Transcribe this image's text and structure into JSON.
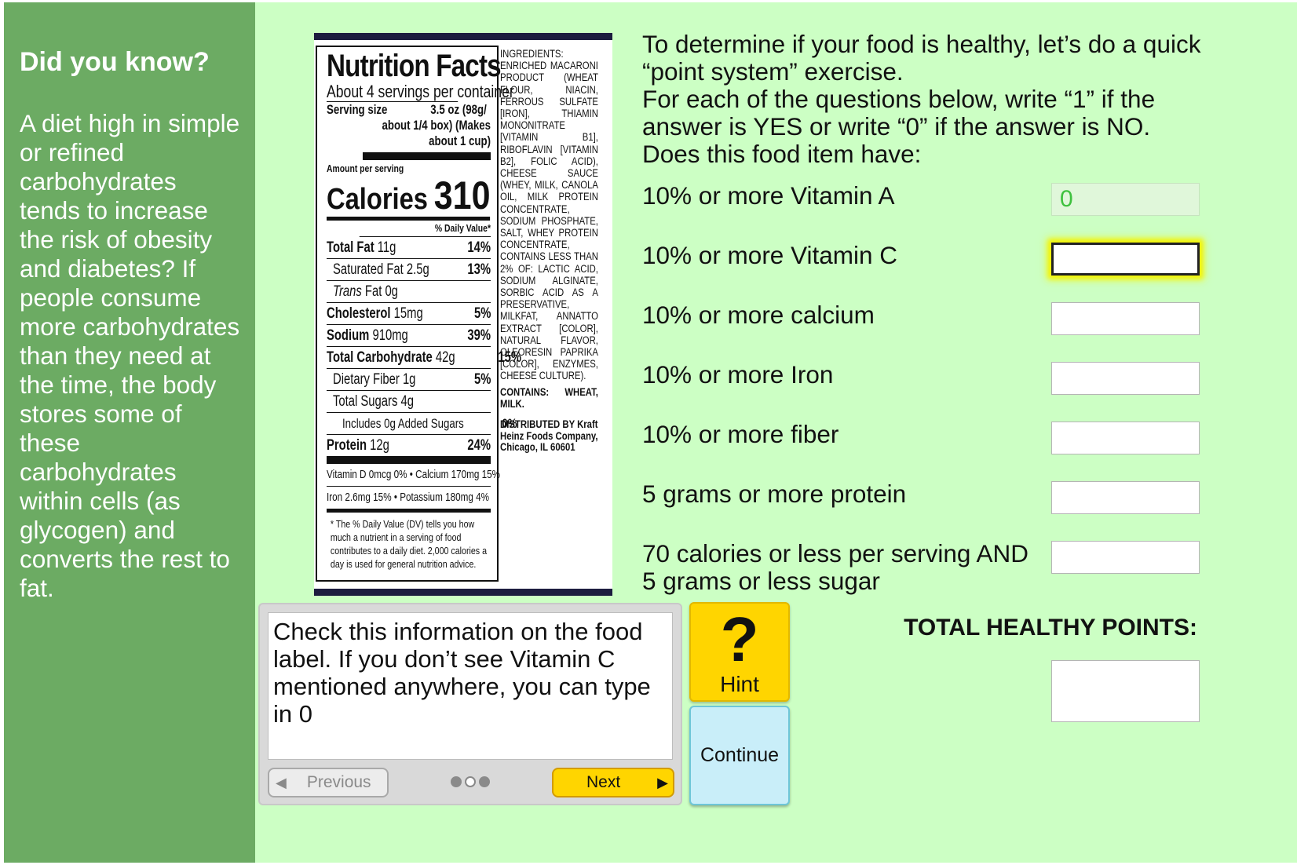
{
  "sidebar": {
    "heading": "Did you know?",
    "body": "A diet high in simple or refined carbohydrates tends to increase the risk of obesity and diabetes? If people consume more carbohydrates than they need at the time, the body stores some of these carbohydrates within cells (as glycogen) and converts the rest to fat."
  },
  "label": {
    "title": "Nutrition Facts",
    "servings": "About 4 servings per container",
    "serving_size_label": "Serving size",
    "serving_size_value": "3.5 oz (98g/",
    "serving_size_value2": "about 1/4 box) (Makes about 1 cup)",
    "amount_per_serving": "Amount per serving",
    "calories_label": "Calories",
    "calories_value": "310",
    "daily_value_header": "% Daily Value*",
    "rows": [
      {
        "name": "Total Fat",
        "amount": "11g",
        "pct": "14%",
        "bold": true,
        "indent": 0
      },
      {
        "name": "Saturated Fat",
        "amount": "2.5g",
        "pct": "13%",
        "bold": false,
        "indent": 1
      },
      {
        "name": "Trans",
        "amount": "Fat 0g",
        "pct": "",
        "bold": false,
        "indent": 1
      },
      {
        "name": "Cholesterol",
        "amount": "15mg",
        "pct": "5%",
        "bold": true,
        "indent": 0
      },
      {
        "name": "Sodium",
        "amount": "910mg",
        "pct": "39%",
        "bold": true,
        "indent": 0
      },
      {
        "name": "Total Carbohydrate",
        "amount": "42g",
        "pct": "15%",
        "bold": true,
        "indent": 0
      },
      {
        "name": "Dietary Fiber",
        "amount": "1g",
        "pct": "5%",
        "bold": false,
        "indent": 1
      },
      {
        "name": "Total Sugars",
        "amount": "4g",
        "pct": "",
        "bold": false,
        "indent": 1
      },
      {
        "name": "Includes 0g Added Sugars",
        "amount": "",
        "pct": "0%",
        "bold": false,
        "indent": 2
      },
      {
        "name": "Protein",
        "amount": "12g",
        "pct": "24%",
        "bold": true,
        "indent": 0
      }
    ],
    "vitamins_line1": "Vitamin D 0mcg 0% • Calcium 170mg 15%",
    "vitamins_line2": "Iron 2.6mg 15% • Potassium 180mg 4%",
    "footnote": "* The % Daily Value (DV) tells you how much a nutrient in a serving of food contributes to a daily diet. 2,000 calories a day is used for general nutrition advice.",
    "ingredients": "INGREDIENTS: ENRICHED MACARONI PRODUCT (WHEAT FLOUR, NIACIN, FERROUS SULFATE [IRON], THIAMIN MONONITRATE [VITAMIN B1], RIBOFLAVIN [VITAMIN B2], FOLIC ACID), CHEESE SAUCE (WHEY, MILK, CANOLA OIL, MILK PROTEIN CONCENTRATE, SODIUM PHOSPHATE, SALT, WHEY PROTEIN CONCENTRATE, CONTAINS LESS THAN 2% OF: LACTIC ACID, SODIUM ALGINATE, SORBIC ACID AS A PRESERVATIVE, MILKFAT, ANNATTO EXTRACT [COLOR], NATURAL FLAVOR, OLEORESIN PAPRIKA [COLOR], ENZYMES, CHEESE CULTURE).",
    "contains": "CONTAINS: WHEAT, MILK.",
    "distributed": "DISTRIBUTED BY Kraft Heinz Foods Company, Chicago, IL 60601"
  },
  "intro": {
    "line1": "To determine if your food is healthy, let’s do a quick “point system” exercise.",
    "line2": "For each of the questions below, write “1” if the answer is YES or write “0” if the answer is NO.",
    "line3": "Does this food item have:"
  },
  "questions": [
    {
      "label": "10% or more Vitamin A",
      "value": "0"
    },
    {
      "label": "10% or more Vitamin C",
      "value": ""
    },
    {
      "label": "10% or more calcium",
      "value": ""
    },
    {
      "label": "10% or more Iron",
      "value": ""
    },
    {
      "label": "10% or more fiber",
      "value": ""
    },
    {
      "label": "5 grams or more protein",
      "value": ""
    },
    {
      "label": "70 calories or less per serving AND",
      "label2": "5 grams or less sugar",
      "value": ""
    }
  ],
  "total": {
    "label": "TOTAL HEALTHY POINTS:",
    "value": ""
  },
  "hint": {
    "text": "Check this information on the food label. If you don’t see Vitamin C mentioned anywhere, you can type in 0",
    "previous_label": "Previous",
    "next_label": "Next",
    "page_current": 1,
    "page_total": 3
  },
  "buttons": {
    "hint_symbol": "?",
    "hint_label": "Hint",
    "continue_label": "Continue"
  },
  "colors": {
    "sidebar": "#6cab63",
    "main_bg": "#ccffc4",
    "hint_button": "#ffd500",
    "continue_button": "#c9eef9",
    "focus_glow": "#f4f400",
    "correct_text": "#3ec13e"
  },
  "icons": {
    "previous": "triangle-left-icon",
    "next": "triangle-right-icon",
    "hint": "question-mark-icon"
  }
}
